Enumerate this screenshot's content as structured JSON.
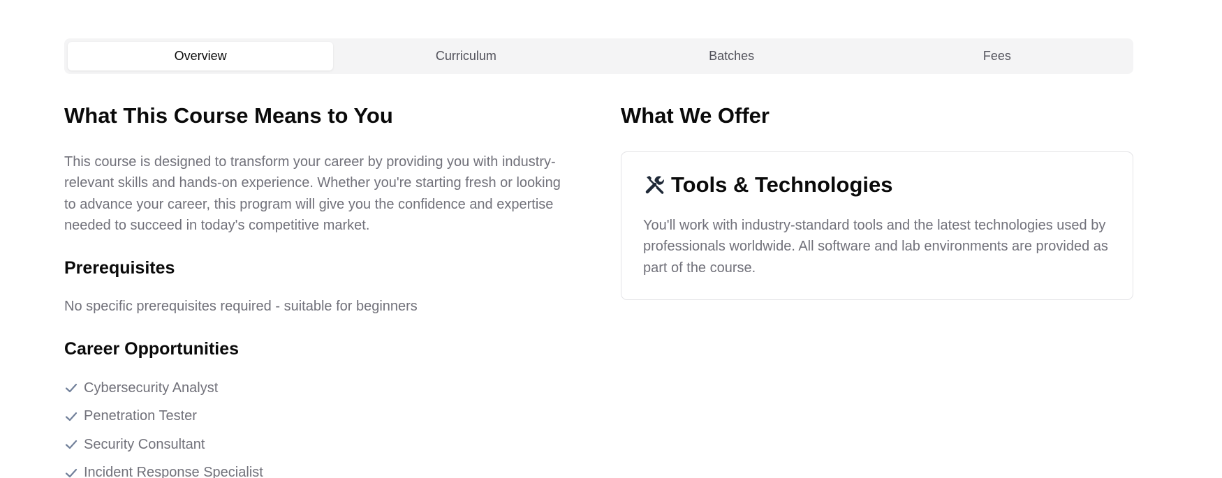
{
  "tabs": [
    {
      "label": "Overview",
      "active": true
    },
    {
      "label": "Curriculum",
      "active": false
    },
    {
      "label": "Batches",
      "active": false
    },
    {
      "label": "Fees",
      "active": false
    }
  ],
  "left": {
    "heading": "What This Course Means to You",
    "intro": "This course is designed to transform your career by providing you with industry-relevant skills and hands-on experience. Whether you're starting fresh or looking to advance your career, this program will give you the confidence and expertise needed to succeed in today's competitive market.",
    "prerequisites_title": "Prerequisites",
    "prerequisites_text": "No specific prerequisites required - suitable for beginners",
    "career_title": "Career Opportunities",
    "careers": [
      "Cybersecurity Analyst",
      "Penetration Tester",
      "Security Consultant",
      "Incident Response Specialist"
    ]
  },
  "right": {
    "heading": "What We Offer",
    "card": {
      "icon": "tools-icon",
      "title": "Tools & Technologies",
      "text": "You'll work with industry-standard tools and the latest technologies used by professionals worldwide. All software and lab environments are provided as part of the course."
    }
  },
  "colors": {
    "muted_text": "#71717a",
    "tab_bg": "#f4f4f5",
    "check": "#71809a",
    "icon": "#1f2937"
  }
}
